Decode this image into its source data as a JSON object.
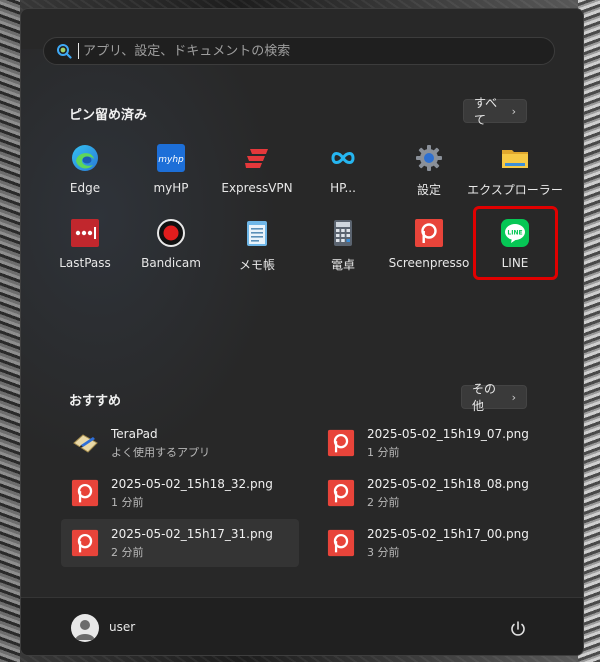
{
  "search": {
    "placeholder": "アプリ、設定、ドキュメントの検索"
  },
  "pinned": {
    "title": "ピン留め済み",
    "all_button": "すべて",
    "apps": [
      {
        "label": "Edge",
        "icon": "edge-icon"
      },
      {
        "label": "myHP",
        "icon": "myhp-icon"
      },
      {
        "label": "ExpressVPN",
        "icon": "expressvpn-icon"
      },
      {
        "label": "HP...",
        "icon": "hp-icon"
      },
      {
        "label": "設定",
        "icon": "settings-gear-icon"
      },
      {
        "label": "エクスプローラー",
        "icon": "folder-icon"
      },
      {
        "label": "LastPass",
        "icon": "lastpass-icon"
      },
      {
        "label": "Bandicam",
        "icon": "bandicam-icon"
      },
      {
        "label": "メモ帳",
        "icon": "notepad-icon"
      },
      {
        "label": "電卓",
        "icon": "calculator-icon"
      },
      {
        "label": "Screenpresso",
        "icon": "screenpresso-icon"
      },
      {
        "label": "LINE",
        "icon": "line-icon"
      }
    ]
  },
  "recommended": {
    "title": "おすすめ",
    "more_button": "その他",
    "items": [
      {
        "name": "TeraPad",
        "sub": "よく使用するアプリ",
        "icon": "terapad-icon"
      },
      {
        "name": "2025-05-02_15h19_07.png",
        "sub": "1 分前",
        "icon": "screenpresso-file-icon"
      },
      {
        "name": "2025-05-02_15h18_32.png",
        "sub": "1 分前",
        "icon": "screenpresso-file-icon"
      },
      {
        "name": "2025-05-02_15h18_08.png",
        "sub": "2 分前",
        "icon": "screenpresso-file-icon"
      },
      {
        "name": "2025-05-02_15h17_31.png",
        "sub": "2 分前",
        "icon": "screenpresso-file-icon"
      },
      {
        "name": "2025-05-02_15h17_00.png",
        "sub": "3 分前",
        "icon": "screenpresso-file-icon"
      }
    ]
  },
  "user": {
    "name": "user"
  },
  "colors": {
    "highlight": "#e00000",
    "line_green": "#06c755",
    "screenpresso_red": "#e8443a"
  }
}
